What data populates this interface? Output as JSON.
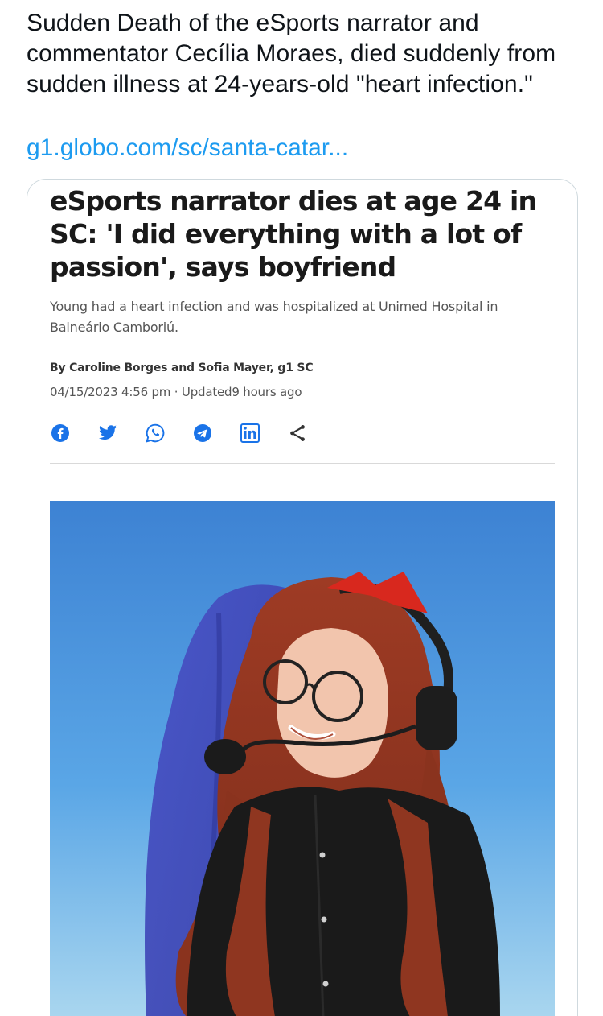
{
  "tweet": {
    "text": "Sudden Death of the eSports narrator and commentator Cecília Moraes, died suddenly from sudden illness at 24-years-old \"heart infection.\"",
    "link": "g1.globo.com/sc/santa-catar..."
  },
  "article": {
    "headline": "eSports narrator dies at age 24 in SC: 'I did everything with a lot of passion', says boyfriend",
    "subtitle": "Young had a heart infection and was hospitalized at Unimed Hospital in Balneário Camboriú.",
    "byline": "By Caroline Borges and Sofia Mayer, g1 SC",
    "dateline": "04/15/2023 4:56 pm · Updated9 hours ago",
    "share_icons": [
      "facebook-icon",
      "twitter-icon",
      "whatsapp-icon",
      "telegram-icon",
      "linkedin-icon",
      "share-icon"
    ],
    "colors": {
      "share_blue": "#1a73e8",
      "link_blue": "#1d9bf0"
    }
  }
}
